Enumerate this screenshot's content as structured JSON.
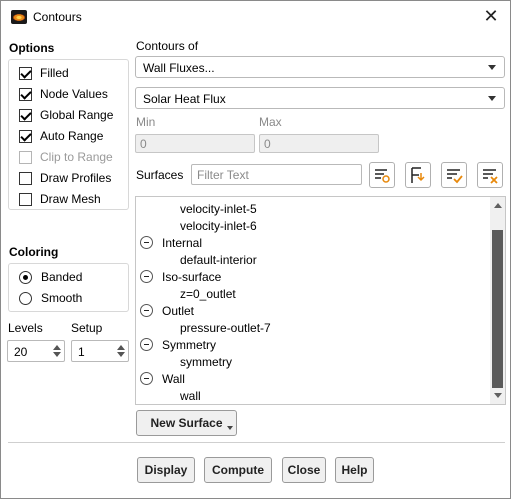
{
  "window": {
    "title": "Contours",
    "close_glyph": "✕"
  },
  "options": {
    "title": "Options",
    "items": [
      {
        "label": "Filled",
        "checked": true,
        "enabled": true
      },
      {
        "label": "Node Values",
        "checked": true,
        "enabled": true
      },
      {
        "label": "Global Range",
        "checked": true,
        "enabled": true
      },
      {
        "label": "Auto Range",
        "checked": true,
        "enabled": true
      },
      {
        "label": "Clip to Range",
        "checked": false,
        "enabled": false
      },
      {
        "label": "Draw Profiles",
        "checked": false,
        "enabled": true
      },
      {
        "label": "Draw Mesh",
        "checked": false,
        "enabled": true
      }
    ]
  },
  "coloring": {
    "title": "Coloring",
    "options": [
      {
        "label": "Banded",
        "selected": true
      },
      {
        "label": "Smooth",
        "selected": false
      }
    ]
  },
  "levels": {
    "label": "Levels",
    "value": "20"
  },
  "setup": {
    "label": "Setup",
    "value": "1"
  },
  "contours_of": {
    "label": "Contours of",
    "category": "Wall Fluxes...",
    "quantity": "Solar Heat Flux"
  },
  "range": {
    "min_label": "Min",
    "min_value": "0",
    "max_label": "Max",
    "max_value": "0"
  },
  "surfaces": {
    "label": "Surfaces",
    "filter_placeholder": "Filter Text",
    "items": [
      {
        "text": "velocity-inlet-5",
        "type": "child"
      },
      {
        "text": "velocity-inlet-6",
        "type": "child"
      },
      {
        "text": "Internal",
        "type": "group"
      },
      {
        "text": "default-interior",
        "type": "child"
      },
      {
        "text": "Iso-surface",
        "type": "group"
      },
      {
        "text": "z=0_outlet",
        "type": "child"
      },
      {
        "text": "Outlet",
        "type": "group"
      },
      {
        "text": "pressure-outlet-7",
        "type": "child"
      },
      {
        "text": "Symmetry",
        "type": "group"
      },
      {
        "text": "symmetry",
        "type": "child"
      },
      {
        "text": "Wall",
        "type": "group"
      },
      {
        "text": "wall",
        "type": "child"
      }
    ]
  },
  "new_surface_label": "New Surface",
  "actions": {
    "display": "Display",
    "compute": "Compute",
    "close": "Close",
    "help": "Help"
  }
}
